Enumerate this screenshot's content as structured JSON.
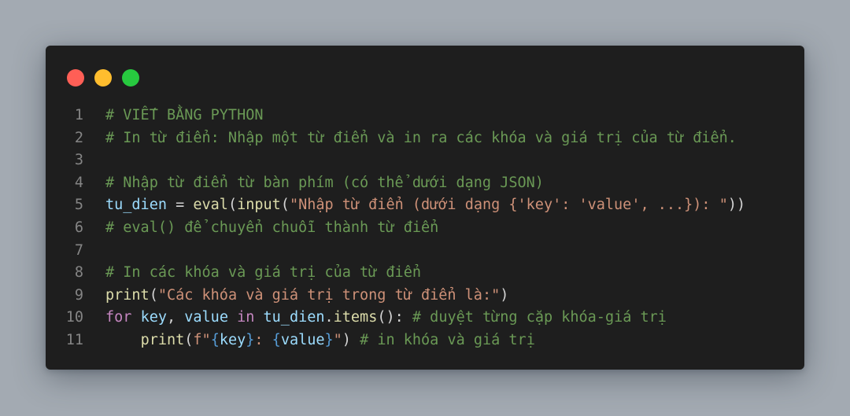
{
  "colors": {
    "close": "#ff5f56",
    "minimize": "#ffbd2e",
    "maximize": "#27c93f",
    "background": "#1e1e1e",
    "comment": "#6a9955",
    "variable": "#9cdcfe",
    "function": "#dcdcaa",
    "string": "#ce9178",
    "keyword": "#c586c0"
  },
  "code": {
    "lines": [
      {
        "n": "1",
        "tokens": [
          {
            "t": "# VIẾT BẰNG PYTHON",
            "c": "comment"
          }
        ]
      },
      {
        "n": "2",
        "tokens": [
          {
            "t": "# In từ điển: Nhập một từ điển và in ra các khóa và giá trị của từ điển.",
            "c": "comment"
          }
        ]
      },
      {
        "n": "3",
        "tokens": []
      },
      {
        "n": "4",
        "tokens": [
          {
            "t": "# Nhập từ điển từ bàn phím (có thể dưới dạng JSON)",
            "c": "comment"
          }
        ]
      },
      {
        "n": "5",
        "tokens": [
          {
            "t": "tu_dien",
            "c": "var"
          },
          {
            "t": " = ",
            "c": "plain"
          },
          {
            "t": "eval",
            "c": "func"
          },
          {
            "t": "(",
            "c": "plain"
          },
          {
            "t": "input",
            "c": "func"
          },
          {
            "t": "(",
            "c": "plain"
          },
          {
            "t": "\"Nhập từ điển (dưới dạng {'key': 'value', ...}): \"",
            "c": "str"
          },
          {
            "t": "))",
            "c": "plain"
          }
        ]
      },
      {
        "n": "6",
        "tokens": [
          {
            "t": "# eval() để chuyển chuỗi thành từ điển",
            "c": "comment"
          }
        ]
      },
      {
        "n": "7",
        "tokens": []
      },
      {
        "n": "8",
        "tokens": [
          {
            "t": "# In các khóa và giá trị của từ điển",
            "c": "comment"
          }
        ]
      },
      {
        "n": "9",
        "tokens": [
          {
            "t": "print",
            "c": "func"
          },
          {
            "t": "(",
            "c": "plain"
          },
          {
            "t": "\"Các khóa và giá trị trong từ điển là:\"",
            "c": "str"
          },
          {
            "t": ")",
            "c": "plain"
          }
        ]
      },
      {
        "n": "10",
        "tokens": [
          {
            "t": "for",
            "c": "kw"
          },
          {
            "t": " ",
            "c": "plain"
          },
          {
            "t": "key",
            "c": "var"
          },
          {
            "t": ", ",
            "c": "plain"
          },
          {
            "t": "value",
            "c": "var"
          },
          {
            "t": " ",
            "c": "plain"
          },
          {
            "t": "in",
            "c": "kw"
          },
          {
            "t": " ",
            "c": "plain"
          },
          {
            "t": "tu_dien",
            "c": "var"
          },
          {
            "t": ".",
            "c": "plain"
          },
          {
            "t": "items",
            "c": "func"
          },
          {
            "t": "(): ",
            "c": "plain"
          },
          {
            "t": "# duyệt từng cặp khóa-giá trị",
            "c": "comment"
          }
        ]
      },
      {
        "n": "11",
        "tokens": [
          {
            "t": "    ",
            "c": "plain"
          },
          {
            "t": "print",
            "c": "func"
          },
          {
            "t": "(",
            "c": "plain"
          },
          {
            "t": "f\"",
            "c": "str"
          },
          {
            "t": "{",
            "c": "brace"
          },
          {
            "t": "key",
            "c": "var"
          },
          {
            "t": "}",
            "c": "brace"
          },
          {
            "t": ": ",
            "c": "str"
          },
          {
            "t": "{",
            "c": "brace"
          },
          {
            "t": "value",
            "c": "var"
          },
          {
            "t": "}",
            "c": "brace"
          },
          {
            "t": "\"",
            "c": "str"
          },
          {
            "t": ") ",
            "c": "plain"
          },
          {
            "t": "# in khóa và giá trị",
            "c": "comment"
          }
        ]
      }
    ]
  }
}
